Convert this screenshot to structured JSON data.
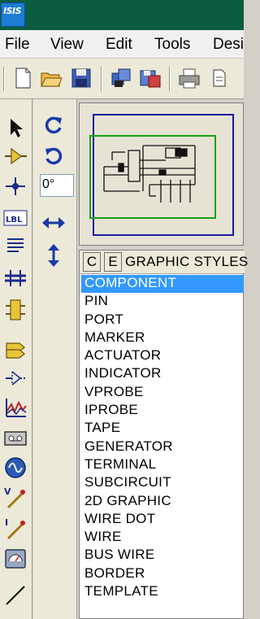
{
  "window": {
    "app_icon_text": "ISIS"
  },
  "menu": {
    "items": [
      "File",
      "View",
      "Edit",
      "Tools",
      "Desi"
    ]
  },
  "toolbar": {
    "buttons": [
      "new-file-icon",
      "open-folder-icon",
      "save-icon",
      "import-icon",
      "export-icon",
      "print-icon",
      "page-setup-icon"
    ]
  },
  "tools": {
    "items": [
      "selection-arrow-icon",
      "component-icon",
      "junction-dot-icon",
      "wire-label-icon",
      "text-script-icon",
      "bus-icon",
      "subcircuit-icon",
      "terminal-icon",
      "device-pin-icon",
      "graph-icon",
      "tape-recorder-icon",
      "generator-icon",
      "voltage-probe-icon",
      "current-probe-icon",
      "virtual-instrument-icon",
      "line-icon"
    ]
  },
  "orientation": {
    "angle_value": "0°",
    "controls": [
      "rotate-clockwise-icon",
      "rotate-anticlockwise-icon",
      "mirror-horizontal-icon",
      "mirror-vertical-icon"
    ]
  },
  "selector": {
    "button_c": "C",
    "button_e": "E",
    "title": "GRAPHIC STYLES",
    "selected_index": 0,
    "items": [
      "COMPONENT",
      "PIN",
      "PORT",
      "MARKER",
      "ACTUATOR",
      "INDICATOR",
      "VPROBE",
      "IPROBE",
      "TAPE",
      "GENERATOR",
      "TERMINAL",
      "SUBCIRCUIT",
      "2D GRAPHIC",
      "WIRE DOT",
      "WIRE",
      "BUS WIRE",
      "BORDER",
      "TEMPLATE"
    ]
  },
  "colors": {
    "titlebar": "#0c5d3f",
    "selection": "#3399ff",
    "overview_sheet_border": "#1a1aa0",
    "overview_view_border": "#16a016"
  }
}
